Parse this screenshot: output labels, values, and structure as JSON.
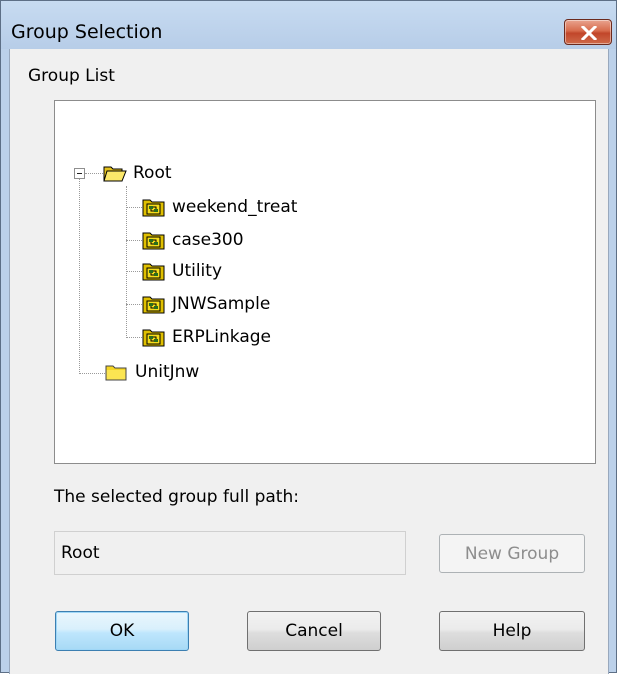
{
  "window": {
    "title": "Group Selection"
  },
  "group_list": {
    "label": "Group List",
    "tree": {
      "root": {
        "label": "Root",
        "expanded": true,
        "icon": "folder-open-icon"
      },
      "children": [
        {
          "label": "weekend_treat",
          "icon": "jobnet-group-icon"
        },
        {
          "label": "case300",
          "icon": "jobnet-group-icon"
        },
        {
          "label": "Utility",
          "icon": "jobnet-group-icon"
        },
        {
          "label": "JNWSample",
          "icon": "jobnet-group-icon"
        },
        {
          "label": "ERPLinkage",
          "icon": "jobnet-group-icon"
        }
      ],
      "sibling": {
        "label": "UnitJnw",
        "icon": "folder-closed-icon"
      }
    }
  },
  "selected_path": {
    "label": "The selected group full path:",
    "value": "Root"
  },
  "buttons": {
    "new_group": "New Group",
    "ok": "OK",
    "cancel": "Cancel",
    "help": "Help"
  },
  "colors": {
    "frame": "#bcd1ea",
    "client": "#f0f0f0",
    "close_button": "#c9553a",
    "folder_yellow": "#f6d624",
    "default_button_border": "#3c7fb1"
  }
}
